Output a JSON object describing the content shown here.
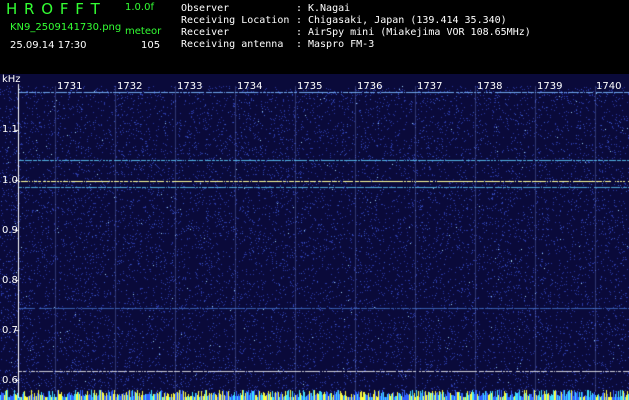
{
  "header": {
    "app_title": "H R O F F T",
    "version": "1.0.0f",
    "filename": "KN9_2509141730.png",
    "mode": "meteor",
    "timestamp": "25.09.14 17:30",
    "count": "105",
    "info": [
      {
        "label": "Observer",
        "value": "K.Nagai"
      },
      {
        "label": "Receiving Location",
        "value": "Chigasaki, Japan (139.414 35.340)"
      },
      {
        "label": "Receiver",
        "value": "AirSpy mini (Miakejima VOR 108.65MHz)"
      },
      {
        "label": "Receiving antenna",
        "value": "Maspro FM-3"
      }
    ],
    "separator": ":"
  },
  "plot": {
    "unit_label": "kHz",
    "y_ticks": [
      "1.1",
      "1.0",
      "0.9",
      "0.8",
      "0.7",
      "0.6"
    ],
    "x_ticks": [
      "1731",
      "1732",
      "1733",
      "1734",
      "1735",
      "1736",
      "1737",
      "1738",
      "1739",
      "1740"
    ],
    "colors": {
      "background": "#0a0a3a",
      "noise": "#2a3aa8",
      "carrier": "#ffff99",
      "line": "#5fd0ff",
      "baseline": "#ffffff"
    }
  }
}
